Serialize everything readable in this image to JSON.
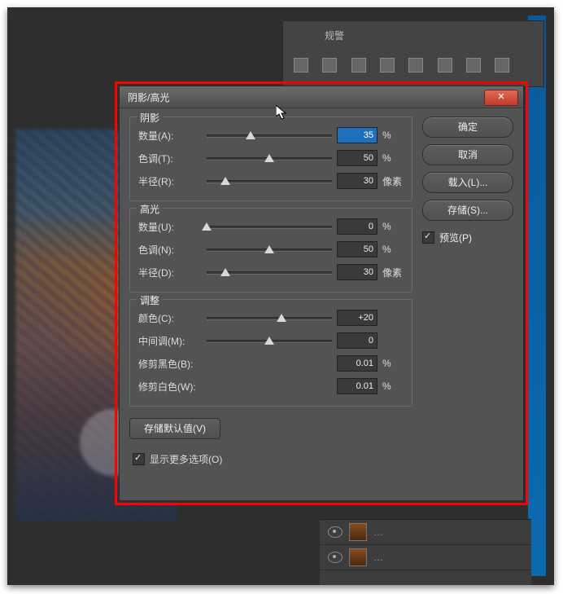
{
  "app": {
    "panel_title": "规警"
  },
  "dialog": {
    "title": "阴影/高光",
    "close_symbol": "✕",
    "buttons": {
      "ok": "确定",
      "cancel": "取消",
      "load": "载入(L)...",
      "save": "存储(S)..."
    },
    "preview": {
      "label": "预览(P)",
      "checked": true
    },
    "groups": {
      "shadows": {
        "title": "阴影",
        "amount": {
          "label": "数量(A):",
          "value": "35",
          "unit": "%",
          "pos": 35
        },
        "tone": {
          "label": "色调(T):",
          "value": "50",
          "unit": "%",
          "pos": 50
        },
        "radius": {
          "label": "半径(R):",
          "value": "30",
          "unit": "像素",
          "pos": 15
        }
      },
      "highlights": {
        "title": "高光",
        "amount": {
          "label": "数量(U):",
          "value": "0",
          "unit": "%",
          "pos": 0
        },
        "tone": {
          "label": "色调(N):",
          "value": "50",
          "unit": "%",
          "pos": 50
        },
        "radius": {
          "label": "半径(D):",
          "value": "30",
          "unit": "像素",
          "pos": 15
        }
      },
      "adjust": {
        "title": "调整",
        "color": {
          "label": "颜色(C):",
          "value": "+20",
          "unit": "",
          "pos": 60
        },
        "midtone": {
          "label": "中间调(M):",
          "value": "0",
          "unit": "",
          "pos": 50
        },
        "clip_black": {
          "label": "修剪黑色(B):",
          "value": "0.01",
          "unit": "%"
        },
        "clip_white": {
          "label": "修剪白色(W):",
          "value": "0.01",
          "unit": "%"
        }
      }
    },
    "save_defaults": "存储默认值(V)",
    "show_more": {
      "label": "显示更多选项(O)",
      "checked": true
    }
  },
  "layers": {
    "row1": "…",
    "row2": "…"
  }
}
